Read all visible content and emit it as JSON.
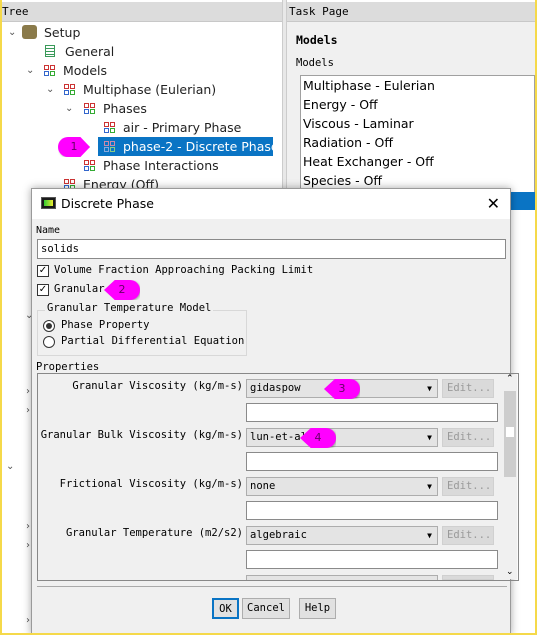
{
  "tree": {
    "header": "Tree",
    "items": [
      {
        "label": "Setup"
      },
      {
        "label": "General"
      },
      {
        "label": "Models"
      },
      {
        "label": "Multiphase (Eulerian)"
      },
      {
        "label": "Phases"
      },
      {
        "label": "air - Primary Phase"
      },
      {
        "label": "phase-2 - Discrete Phase"
      },
      {
        "label": "Phase Interactions"
      },
      {
        "label": "Energy (Off)"
      }
    ]
  },
  "task_page": {
    "header": "Task Page",
    "title": "Models",
    "list_label": "Models",
    "models": [
      "Multiphase - Eulerian",
      "Energy - Off",
      "Viscous - Laminar",
      "Radiation - Off",
      "Heat Exchanger - Off",
      "Species - Off"
    ]
  },
  "dialog": {
    "title": "Discrete Phase",
    "close_icon": "close-icon",
    "name_label": "Name",
    "name_value": "solids",
    "vol_fraction_label": "Volume Fraction Approaching Packing Limit",
    "vol_fraction_checked": true,
    "granular_label": "Granular",
    "granular_checked": true,
    "temp_model_group": "Granular Temperature Model",
    "temp_model_options": [
      "Phase Property",
      "Partial Differential Equation"
    ],
    "temp_model_selected": "Phase Property",
    "properties_label": "Properties",
    "properties": [
      {
        "label": "Granular Viscosity (kg/m-s)",
        "value": "gidaspow",
        "edit": "Edit..."
      },
      {
        "label": "Granular Bulk Viscosity (kg/m-s)",
        "value": "lun-et-al",
        "edit": "Edit..."
      },
      {
        "label": "Frictional Viscosity (kg/m-s)",
        "value": "none",
        "edit": "Edit..."
      },
      {
        "label": "Granular Temperature (m2/s2)",
        "value": "algebraic",
        "edit": "Edit..."
      }
    ],
    "buttons": {
      "ok": "OK",
      "cancel": "Cancel",
      "help": "Help"
    }
  },
  "callouts": [
    "1",
    "2",
    "3",
    "4"
  ],
  "colors": {
    "selection": "#0a74c4",
    "callout": "#ff00ff",
    "frame": "#f5d94a"
  }
}
